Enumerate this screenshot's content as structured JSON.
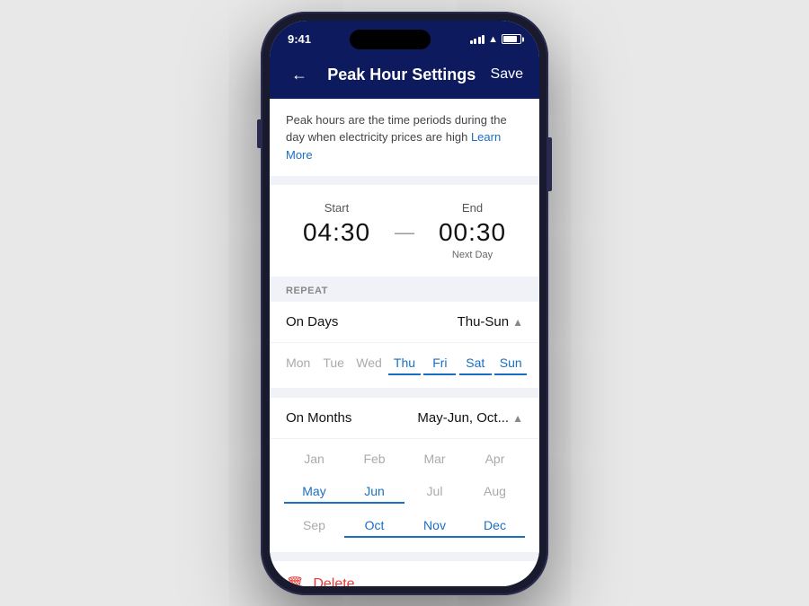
{
  "statusBar": {
    "time": "9:41",
    "signal": "signal",
    "wifi": "wifi",
    "battery": "battery"
  },
  "nav": {
    "back_label": "←",
    "title": "Peak Hour Settings",
    "save_label": "Save"
  },
  "info": {
    "description": "Peak hours are the time periods during the day when electricity prices are high",
    "learn_more_label": "Learn More"
  },
  "time": {
    "start_label": "Start",
    "start_value": "04:30",
    "dash": "—",
    "end_label": "End",
    "end_value": "00:30",
    "end_sub": "Next Day"
  },
  "repeat": {
    "section_label": "REPEAT",
    "on_days_label": "On Days",
    "on_days_value": "Thu-Sun",
    "on_months_label": "On Months",
    "on_months_value": "May-Jun, Oct..."
  },
  "days": [
    {
      "label": "Mon",
      "selected": false
    },
    {
      "label": "Tue",
      "selected": false
    },
    {
      "label": "Wed",
      "selected": false
    },
    {
      "label": "Thu",
      "selected": true
    },
    {
      "label": "Fri",
      "selected": true
    },
    {
      "label": "Sat",
      "selected": true
    },
    {
      "label": "Sun",
      "selected": true
    }
  ],
  "months": [
    {
      "label": "Jan",
      "selected": false
    },
    {
      "label": "Feb",
      "selected": false
    },
    {
      "label": "Mar",
      "selected": false
    },
    {
      "label": "Apr",
      "selected": false
    },
    {
      "label": "May",
      "selected": true
    },
    {
      "label": "Jun",
      "selected": true
    },
    {
      "label": "Jul",
      "selected": false
    },
    {
      "label": "Aug",
      "selected": false
    },
    {
      "label": "Sep",
      "selected": false
    },
    {
      "label": "Oct",
      "selected": true
    },
    {
      "label": "Nov",
      "selected": true
    },
    {
      "label": "Dec",
      "selected": true
    }
  ],
  "delete": {
    "label": "Delete"
  }
}
